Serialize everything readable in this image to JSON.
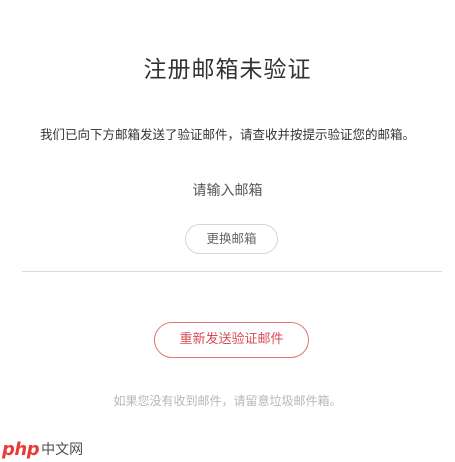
{
  "dialog": {
    "title": "注册邮箱未验证",
    "description": "我们已向下方邮箱发送了验证邮件，请查收并按提示验证您的邮箱。",
    "email_placeholder": "请输入邮箱",
    "change_email_label": "更换邮箱",
    "resend_label": "重新发送验证邮件",
    "hint": "如果您没有收到邮件，请留意垃圾邮件箱。"
  },
  "watermark": {
    "logo": "php",
    "site": "中文网"
  },
  "colors": {
    "accent": "#d94a55",
    "text_primary": "#333333",
    "text_muted": "#b7b7b7",
    "border": "#d6d6d6"
  }
}
